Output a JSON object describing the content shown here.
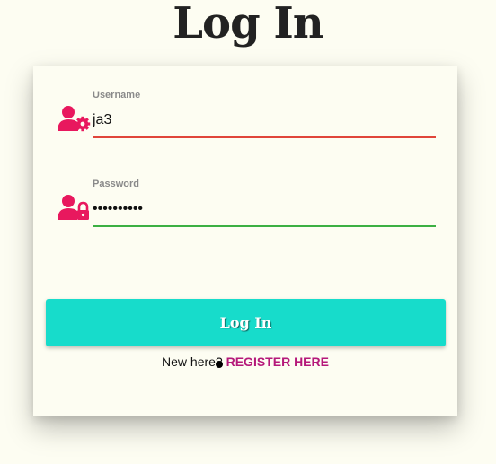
{
  "page": {
    "title": "Log In"
  },
  "form": {
    "username": {
      "label": "Username",
      "value": "ja3",
      "icon": "user-gear-icon",
      "underline_color": "#e0453a"
    },
    "password": {
      "label": "Password",
      "value": "••••••••••",
      "icon": "user-lock-icon",
      "underline_color": "#3cb043"
    },
    "submit_label": "Log In",
    "register_prompt": "New here?",
    "register_link": "REGISTER HERE"
  },
  "colors": {
    "accent": "#e8185e",
    "button": "#17dccb",
    "link": "#b5187a",
    "background": "#fdfdf2"
  }
}
